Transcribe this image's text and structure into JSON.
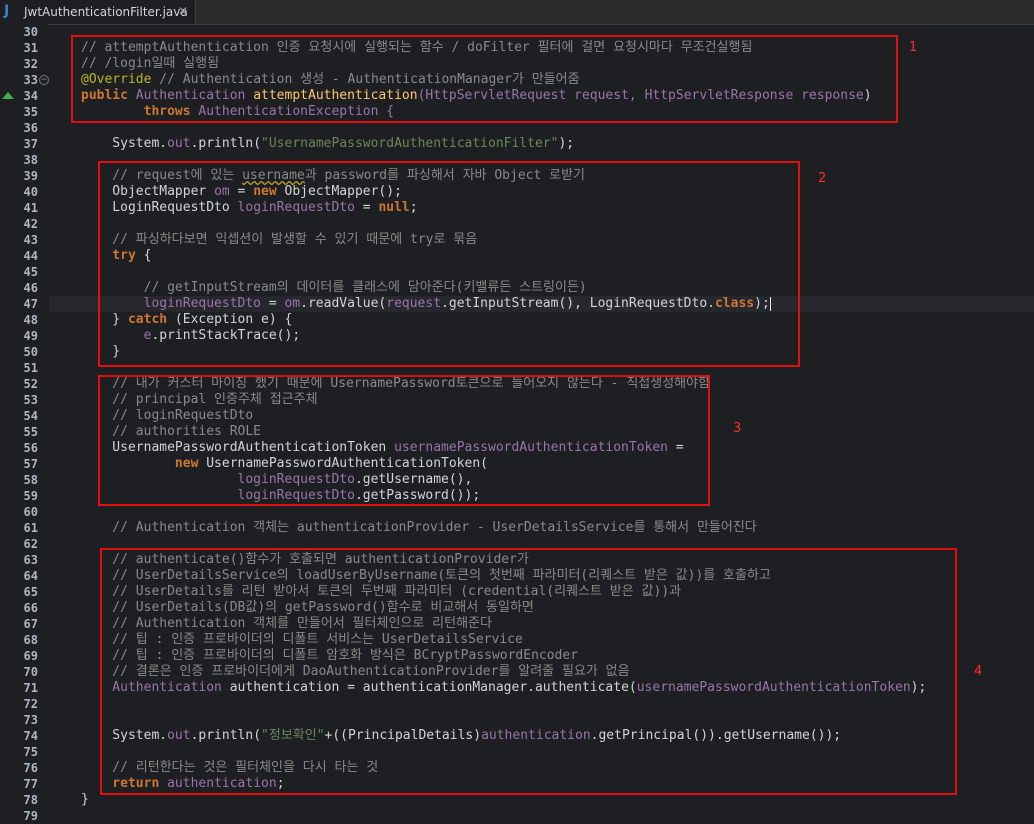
{
  "tab": {
    "icon": "java-file-icon",
    "icon_text": "J",
    "label": "JwtAuthenticationFilter.java",
    "close": "✕"
  },
  "line_numbers": [
    "30",
    "31",
    "32",
    "33",
    "34",
    "35",
    "36",
    "37",
    "38",
    "39",
    "40",
    "41",
    "42",
    "43",
    "44",
    "45",
    "46",
    "47",
    "48",
    "49",
    "50",
    "51",
    "52",
    "53",
    "54",
    "55",
    "56",
    "57",
    "58",
    "59",
    "60",
    "61",
    "62",
    "63",
    "64",
    "65",
    "66",
    "67",
    "68",
    "69",
    "70",
    "71",
    "72",
    "73",
    "74",
    "75",
    "76",
    "77",
    "78",
    "79"
  ],
  "box_labels": [
    "1",
    "2",
    "3",
    "4"
  ],
  "code": {
    "l31": "// attemptAuthentication 인증 요청시에 실행되는 함수 / doFilter 필터에 걸면 요청시마다 무조건실행됨",
    "l32": "// /login일때 실행됨",
    "l33a": "@Override",
    "l33b": " // Authentication 생성 - AuthenticationManager가 만들어줌",
    "l34a": "public",
    "l34b": " Authentication ",
    "l34c": "attemptAuthentication",
    "l34d": "(HttpServletRequest ",
    "l34e": "request",
    "l34f": ", HttpServletResponse ",
    "l34g": "response",
    "l34h": ")",
    "l35a": "        throws",
    "l35b": " AuthenticationException {",
    "l37a": "    System.",
    "l37b": "out",
    "l37c": ".println(",
    "l37d": "\"UsernamePasswordAuthenticationFilter\"",
    "l37e": ");",
    "l39a": "    // request에 있는 ",
    "l39b": "username",
    "l39c": "과 password를 파싱해서 자바 Object 로받기",
    "l40a": "    ObjectMapper ",
    "l40b": "om",
    "l40c": " = ",
    "l40d": "new",
    "l40e": " ObjectMapper();",
    "l41a": "    LoginRequestDto ",
    "l41b": "loginRequestDto",
    "l41c": " = ",
    "l41d": "null",
    "l41e": ";",
    "l43": "    // 파싱하다보면 익셉션이 발생할 수 있기 때문에 try로 묶음",
    "l44a": "    try",
    "l44b": " {",
    "l46": "        // getInputStream의 데이터를 클래스에 담아준다(키밸류든 스트링이든)",
    "l47a": "        loginRequestDto",
    "l47b": " = ",
    "l47c": "om",
    "l47d": ".readValue(",
    "l47e": "request",
    "l47f": ".getInputStream(), LoginRequestDto.",
    "l47g": "class",
    "l47h": ");",
    "l48a": "    } ",
    "l48b": "catch",
    "l48c": " (Exception e) {",
    "l49a": "        e",
    "l49b": ".printStackTrace();",
    "l50": "    }",
    "l52": "    // 내가 커스터 마이징 했기 때문에 UsernamePassword토큰으로 들어오지 않는다 - 직접생성해야함",
    "l53": "    // principal 인증주체 접근주체",
    "l54": "    // loginRequestDto",
    "l55": "    // authorities ROLE",
    "l56a": "    UsernamePasswordAuthenticationToken ",
    "l56b": "usernamePasswordAuthenticationToken",
    "l56c": " =",
    "l57a": "            new",
    "l57b": " UsernamePasswordAuthenticationToken(",
    "l58a": "                    loginRequestDto",
    "l58b": ".getUsername(),",
    "l59a": "                    loginRequestDto",
    "l59b": ".getPassword());",
    "l61": "    // Authentication 객체는 authenticationProvider - UserDetailsService를 통해서 만들어진다",
    "l63": "    // authenticate()함수가 호출되면 authenticationProvider가",
    "l64": "    // UserDetailsService의 loadUserByUsername(토큰의 첫번째 파라미터(리퀘스트 받은 값))를 호출하고",
    "l65": "    // UserDetails를 리턴 받아서 토큰의 두번째 파라미터 (credential(리퀘스트 받은 값))과",
    "l66": "    // UserDetails(DB값)의 getPassword()함수로 비교해서 동일하면",
    "l67": "    // Authentication 객체를 만들어서 필터체인으로 리턴해준다",
    "l68": "    // 팁 : 인증 프로바이더의 디폴트 서비스는 UserDetailsService",
    "l69": "    // 팁 : 인증 프로바이더의 디폴트 암호화 방식은 BCryptPasswordEncoder",
    "l70": "    // 결론은 인증 프로바이더에게 DaoAuthenticationProvider를 알려줄 필요가 없음",
    "l71a": "    Authentication ",
    "l71b": "authentication",
    "l71c": " = ",
    "l71d": "authenticationManager",
    "l71e": ".authenticate(",
    "l71f": "usernamePasswordAuthenticationToken",
    "l71g": ");",
    "l74a": "    System.",
    "l74b": "out",
    "l74c": ".println(",
    "l74d": "\"정보확인\"",
    "l74e": "+((PrincipalDetails)",
    "l74f": "authentication",
    "l74g": ".getPrincipal()).getUsername());",
    "l76": "    // 리턴한다는 것은 필터체인을 다시 타는 것",
    "l77a": "    return",
    "l77b": " authentication",
    "l77c": ";",
    "l78": "}"
  }
}
